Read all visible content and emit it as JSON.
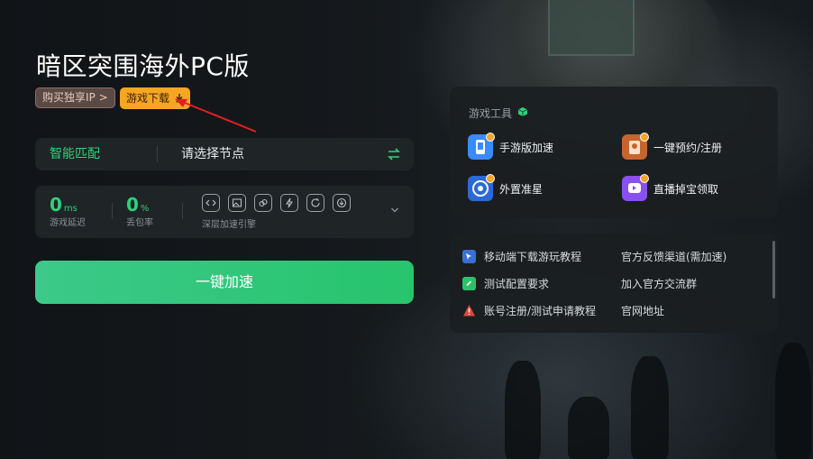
{
  "title": "暗区突围海外PC版",
  "buttons": {
    "buy_ip": "购买独享IP >",
    "download": "游戏下载"
  },
  "node": {
    "smart_match": "智能匹配",
    "select_placeholder": "请选择节点"
  },
  "stats": {
    "latency": {
      "value": "0",
      "unit": "ms",
      "label": "游戏延迟"
    },
    "packet_loss": {
      "value": "0",
      "unit": "%",
      "label": "丢包率"
    },
    "engine_label": "深层加速引擎"
  },
  "accelerate": "一键加速",
  "tools": {
    "title": "游戏工具",
    "items": [
      {
        "label": "手游版加速",
        "icon": "phone-icon",
        "color": "#3a8bff"
      },
      {
        "label": "一键预约/注册",
        "icon": "register-icon",
        "color": "#c8642e"
      },
      {
        "label": "外置准星",
        "icon": "crosshair-icon",
        "color": "#2a6ad8"
      },
      {
        "label": "直播掉宝领取",
        "icon": "live-icon",
        "color": "#8a4ff0"
      }
    ]
  },
  "links": [
    {
      "label": "移动端下载游玩教程",
      "icon": "mobile-tutorial-icon",
      "color": "#3a6fd8"
    },
    {
      "label": "官方反馈渠道(需加速)",
      "icon": "",
      "color": ""
    },
    {
      "label": "测试配置要求",
      "icon": "check-icon",
      "color": "#2fc16a"
    },
    {
      "label": "加入官方交流群",
      "icon": "",
      "color": ""
    },
    {
      "label": "账号注册/测试申请教程",
      "icon": "warning-icon",
      "color": "#e24a3a"
    },
    {
      "label": "官网地址",
      "icon": "",
      "color": ""
    }
  ],
  "colors": {
    "accent_green": "#2fd17a",
    "download_orange": "#f5a623",
    "arrow_red": "#e02020"
  }
}
